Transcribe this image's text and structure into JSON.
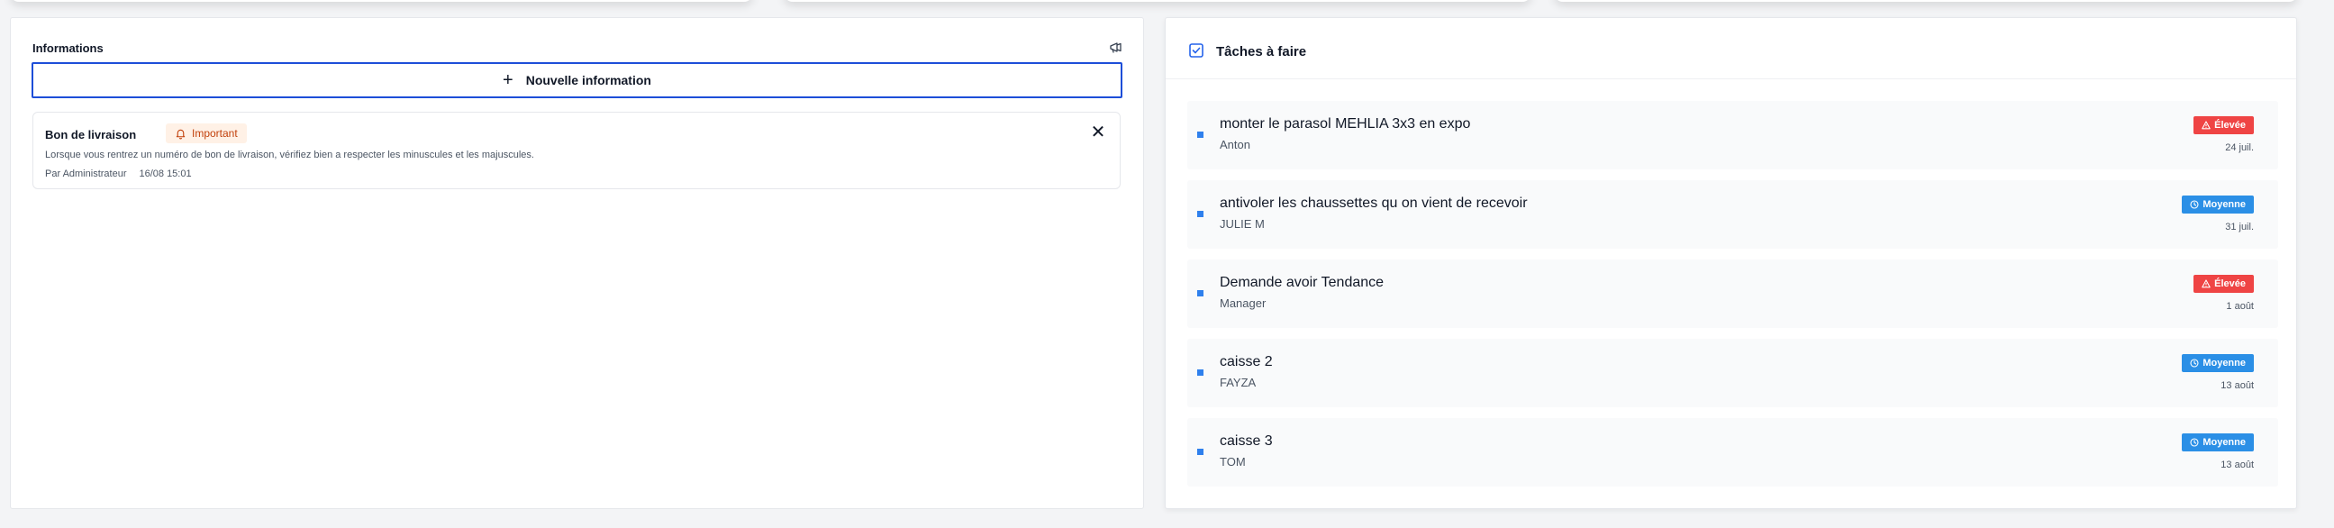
{
  "info_panel": {
    "title": "Informations",
    "new_button_label": "Nouvelle information",
    "cards": [
      {
        "title": "Bon de livraison",
        "badge": "Important",
        "body": "Lorsque vous rentrez un numéro de bon de livraison, vérifiez bien a respecter les minuscules et les majuscules.",
        "author": "Par Administrateur",
        "date": "16/08 15:01",
        "close_glyph": "✕"
      }
    ]
  },
  "tasks_panel": {
    "title": "Tâches à faire",
    "tasks": [
      {
        "title": "monter le parasol MEHLIA 3x3 en expo",
        "assignee": "Anton",
        "priority": "Élevée",
        "priority_level": "high",
        "date": "24 juil."
      },
      {
        "title": "antivoler les chaussettes qu on vient de recevoir",
        "assignee": "JULIE M",
        "priority": "Moyenne",
        "priority_level": "medium",
        "date": "31 juil."
      },
      {
        "title": "Demande avoir Tendance",
        "assignee": "Manager",
        "priority": "Élevée",
        "priority_level": "high",
        "date": "1 août"
      },
      {
        "title": "caisse 2",
        "assignee": "FAYZA",
        "priority": "Moyenne",
        "priority_level": "medium",
        "date": "13 août"
      },
      {
        "title": "caisse 3",
        "assignee": "TOM",
        "priority": "Moyenne",
        "priority_level": "medium",
        "date": "13 août"
      }
    ]
  },
  "colors": {
    "accent": "#1d4ed8",
    "task_bullet": "#2f80ed",
    "priority_high": "#ef4444",
    "priority_medium": "#2b8fe6",
    "important_bg": "#fff1e6",
    "important_text": "#c2410c"
  },
  "icons": {
    "info_header": "megaphone-icon",
    "tasks_header": "checkbox-icon",
    "important": "bell-icon",
    "priority_high": "warning-triangle-icon",
    "priority_medium": "clock-icon"
  }
}
